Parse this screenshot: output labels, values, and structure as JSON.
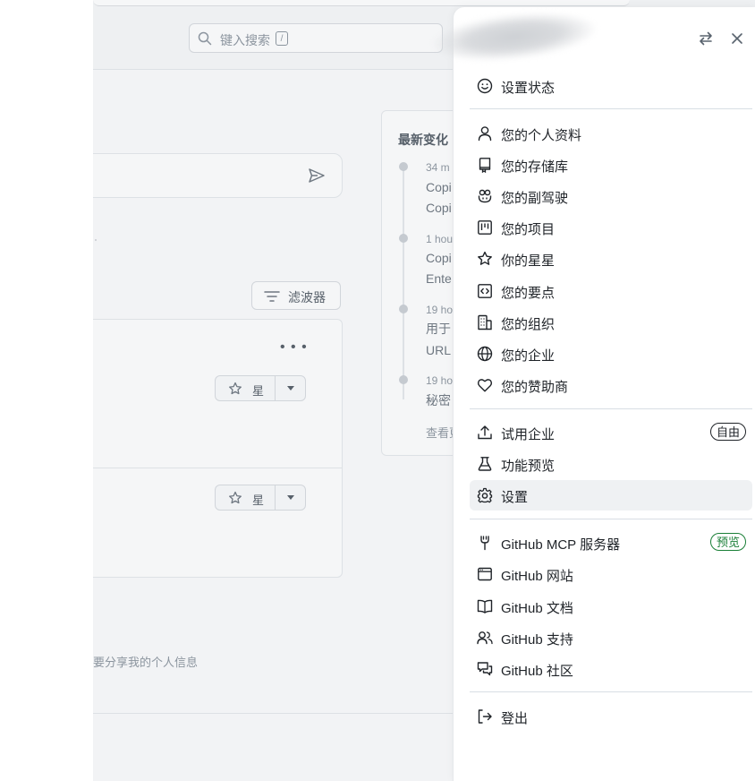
{
  "search": {
    "placeholder": "键入搜索",
    "shortcut": "/"
  },
  "filter": {
    "label": "滤波器"
  },
  "repo_cards": {
    "star_label": "星"
  },
  "latest": {
    "title": "最新变化",
    "items": [
      {
        "time": "34 m",
        "line1": "Copi",
        "line2": "Copi"
      },
      {
        "time": "1 hou",
        "line1": "Copi",
        "line2": "Ente"
      },
      {
        "time": "19 ho",
        "line1": "用于",
        "line2": "URL"
      },
      {
        "time": "19 ho",
        "line1": "秘密",
        "line2": ""
      }
    ],
    "more": "查看更"
  },
  "privacy_text": "要分享我的个人信息",
  "menu": {
    "header": {
      "switch_icon": "arrows-switch-icon",
      "close_icon": "close-icon"
    },
    "set_status": "设置状态",
    "profile_items": [
      {
        "label": "您的个人资料",
        "icon": "person-icon"
      },
      {
        "label": "您的存储库",
        "icon": "repo-icon"
      },
      {
        "label": "您的副驾驶",
        "icon": "copilot-icon"
      },
      {
        "label": "您的项目",
        "icon": "project-icon"
      },
      {
        "label": "你的星星",
        "icon": "star-icon"
      },
      {
        "label": "您的要点",
        "icon": "code-square-icon"
      },
      {
        "label": "您的组织",
        "icon": "organization-icon"
      },
      {
        "label": "您的企业",
        "icon": "globe-icon"
      },
      {
        "label": "您的赞助商",
        "icon": "heart-icon"
      }
    ],
    "try_enterprise": {
      "label": "试用企业",
      "badge": "自由"
    },
    "feature_preview": "功能预览",
    "settings": "设置",
    "github_items": [
      {
        "label": "GitHub MCP 服务器",
        "badge": "预览",
        "icon": "mcp-icon"
      },
      {
        "label": "GitHub 网站",
        "icon": "browser-icon"
      },
      {
        "label": "GitHub 文档",
        "icon": "book-icon"
      },
      {
        "label": "GitHub 支持",
        "icon": "people-icon"
      },
      {
        "label": "GitHub 社区",
        "icon": "comment-discussion-icon"
      }
    ],
    "sign_out": "登出"
  }
}
